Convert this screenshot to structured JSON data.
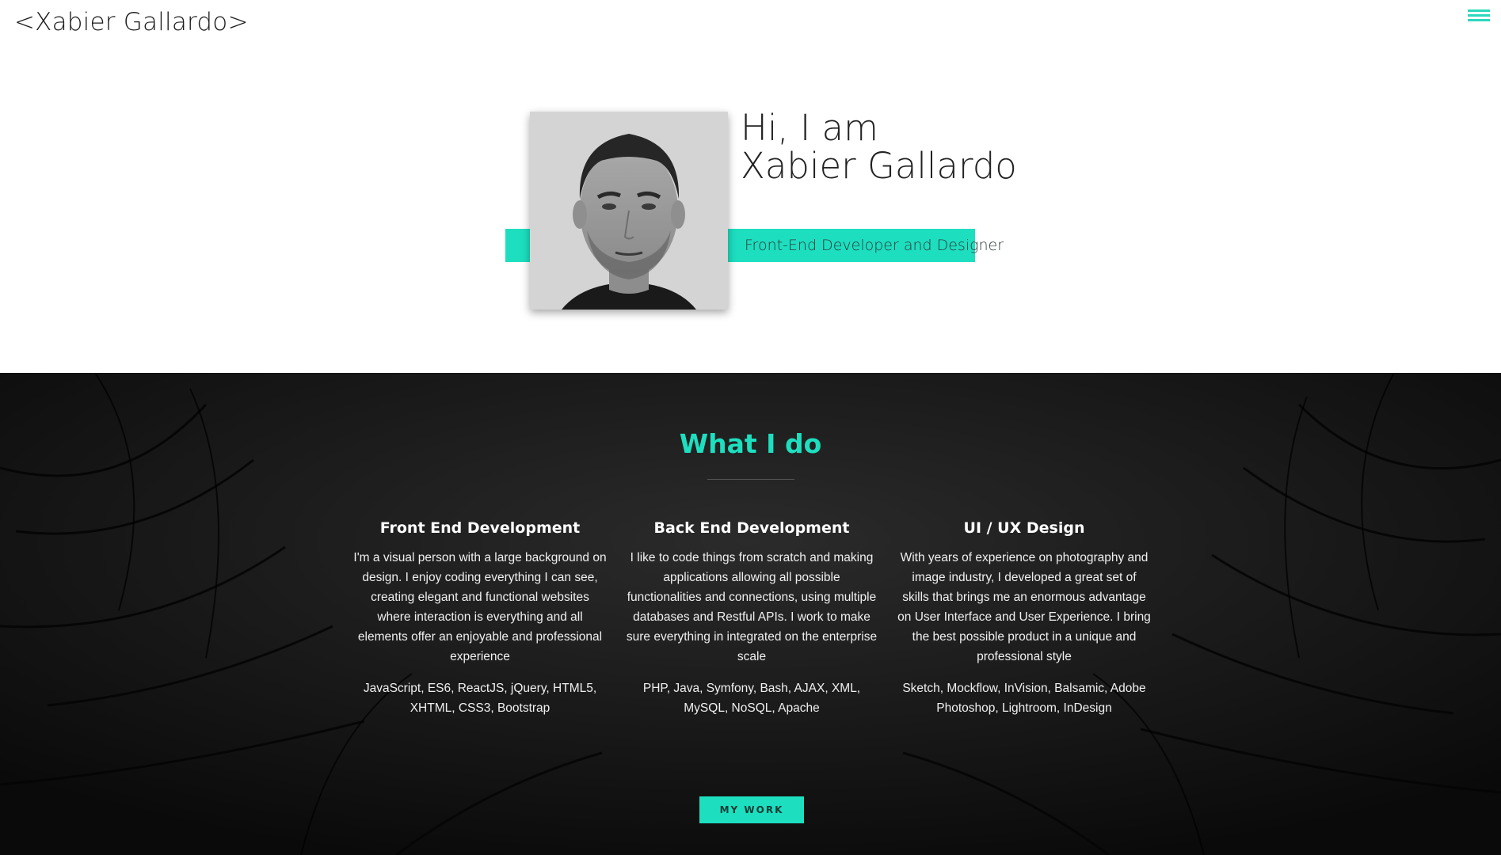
{
  "header": {
    "logo": "<Xabier Gallardo>"
  },
  "hero": {
    "greeting_line1": "Hi, I am",
    "greeting_line2": "Xabier Gallardo",
    "role": "Front-End Developer and Designer"
  },
  "services": {
    "title": "What I do",
    "columns": [
      {
        "title": "Front End Development",
        "description": "I'm a visual person with a large background on design. I enjoy coding everything I can see, creating elegant and functional websites where interaction is everything and all elements offer an enjoyable and professional experience",
        "tech": "JavaScript, ES6, ReactJS, jQuery, HTML5, XHTML, CSS3, Bootstrap"
      },
      {
        "title": "Back End Development",
        "description": "I like to code things from scratch and making applications allowing all possible functionalities and connections, using multiple databases and Restful APIs. I work to make sure everything in integrated on the enterprise scale",
        "tech": "PHP, Java, Symfony, Bash, AJAX, XML, MySQL, NoSQL, Apache"
      },
      {
        "title": "UI / UX Design",
        "description": "With years of experience on photography and image industry, I developed a great set of skills that brings me an enormous advantage on User Interface and User Experience. I bring the best possible product in a unique and professional style",
        "tech": "Sketch, Mockflow, InVision, Balsamic, Adobe Photoshop, Lightroom, InDesign"
      }
    ],
    "button_label": "MY WORK"
  },
  "colors": {
    "accent": "#1ddfc0",
    "dark_bg": "#0d0d0d"
  },
  "icons": {
    "menu": "hamburger-menu-icon"
  }
}
